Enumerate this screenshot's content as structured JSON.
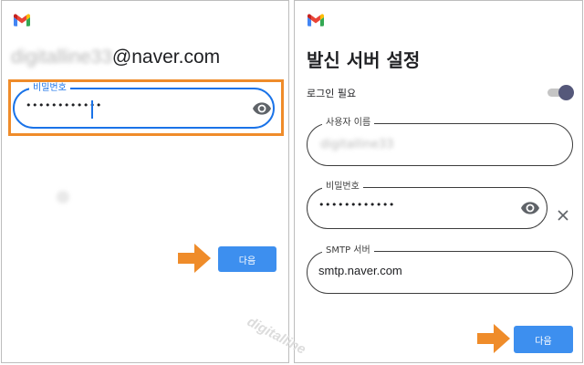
{
  "left_screen": {
    "email_user_blurred": "digitalline33",
    "email_domain": "@naver.com",
    "password": {
      "label": "비밀번호",
      "value_masked": "••••••••••••"
    },
    "next_label": "다음"
  },
  "right_screen": {
    "title": "발신 서버 설정",
    "login_required_label": "로그인 필요",
    "login_required_on": true,
    "username": {
      "label": "사용자 이름",
      "value_blurred": "digitalline33"
    },
    "password": {
      "label": "비밀번호",
      "value_masked": "••••••••••••"
    },
    "smtp": {
      "label": "SMTP 서버",
      "value": "smtp.naver.com"
    },
    "next_label": "다음"
  },
  "watermark": "digitalline",
  "colors": {
    "accent_blue": "#1a73e8",
    "button_blue": "#3d8fef",
    "highlight_orange": "#ef8c2a",
    "arrow_orange": "#ef8c2a",
    "toggle_knob": "#55587a"
  },
  "icons": [
    "gmail-icon",
    "eye-icon",
    "close-icon",
    "arrow-right-icon"
  ]
}
